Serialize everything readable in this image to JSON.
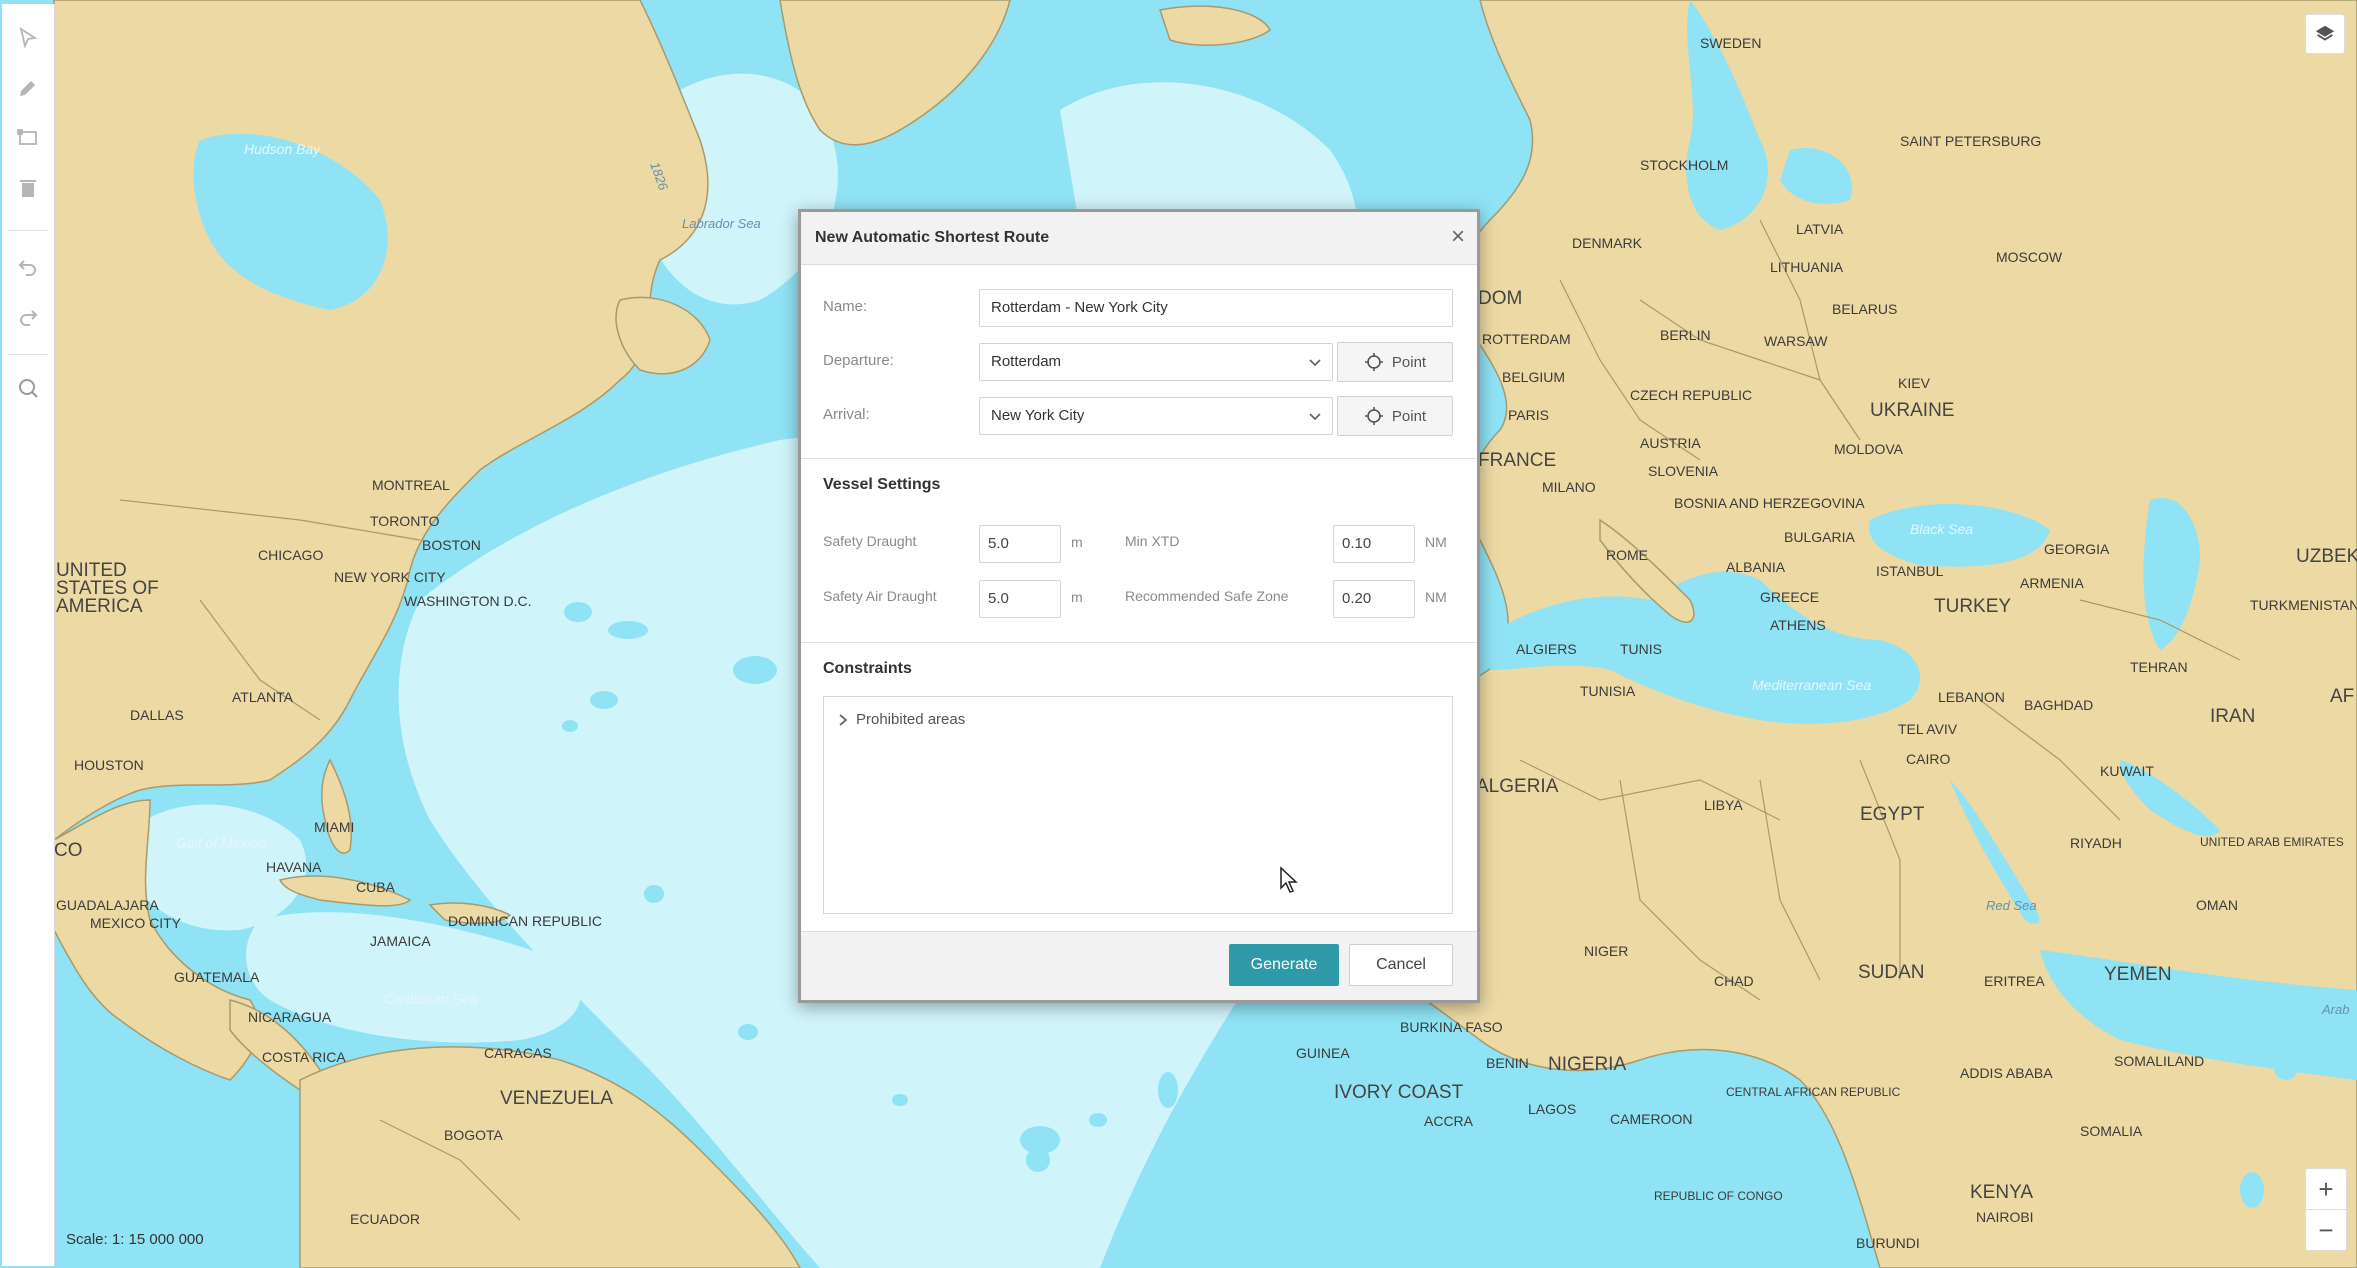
{
  "toolbar": {
    "tools": [
      {
        "name": "select-tool",
        "icon": "pointer-icon"
      },
      {
        "name": "draw-tool",
        "icon": "pencil-icon"
      },
      {
        "name": "area-tool",
        "icon": "rectangle-icon"
      },
      {
        "name": "delete-tool",
        "icon": "trash-icon"
      },
      {
        "name": "undo-tool",
        "icon": "undo-icon"
      },
      {
        "name": "redo-tool",
        "icon": "redo-icon"
      },
      {
        "name": "search-tool",
        "icon": "search-icon"
      }
    ]
  },
  "map": {
    "scale_text": "Scale: 1: 15 000 000",
    "zoom_in": "+",
    "zoom_out": "−",
    "layers_icon": "layers-icon",
    "colors": {
      "water": "#8fe3f4",
      "deep_water": "#cff4fa",
      "land": "#ecd9a4",
      "border": "#a89a6c"
    },
    "labels": {
      "hudson_bay": "Hudson Bay",
      "labrador_sea": "Labrador Sea",
      "usa": [
        "UNITED",
        "STATES OF",
        "AMERICA"
      ],
      "montreal": "MONTREAL",
      "toronto": "TORONTO",
      "boston": "BOSTON",
      "chicago": "CHICAGO",
      "new_york": "NEW YORK CITY",
      "washington": "WASHINGTON D.C.",
      "dallas": "DALLAS",
      "atlanta": "ATLANTA",
      "houston": "HOUSTON",
      "gulf_of_mexico": "Gulf of Mexico",
      "miami": "MIAMI",
      "havana": "HAVANA",
      "cuba": "CUBA",
      "mexico": "CO",
      "guadalajara": "GUADALAJARA",
      "mexico_city": "MEXICO CITY",
      "jamaica": "JAMAICA",
      "dominican_republic": "DOMINICAN REPUBLIC",
      "guatemala": "GUATEMALA",
      "nicaragua": "NICARAGUA",
      "costa_rica": "COSTA RICA",
      "caribbean_sea": "Caribbean Sea",
      "caracas": "CARACAS",
      "venezuela": "VENEZUELA",
      "bogota": "BOGOTA",
      "ecuador": "ECUADOR",
      "sweden": "SWEDEN",
      "stockholm": "STOCKHOLM",
      "saint_petersburg": "SAINT PETERSBURG",
      "moscow": "MOSCOW",
      "latvia": "LATVIA",
      "lithuania": "LITHUANIA",
      "belarus": "BELARUS",
      "denmark": "DENMARK",
      "berlin": "BERLIN",
      "warsaw": "WARSAW",
      "kiev": "KIEV",
      "ukraine": "UKRAINE",
      "moldova": "MOLDOVA",
      "czech": "CZECH REPUBLIC",
      "austria": "AUSTRIA",
      "slovenia": "SLOVENIA",
      "bosnia": "BOSNIA AND HERZEGOVINA",
      "bulgaria": "BULGARIA",
      "albania": "ALBANIA",
      "greece": "GREECE",
      "athens": "ATHENS",
      "istanbul": "ISTANBUL",
      "black_sea": "Black Sea",
      "georgia": "GEORGIA",
      "armenia": "ARMENIA",
      "turkey": "TURKEY",
      "uzbek": "UZBEK",
      "turkmenistan": "TURKMENISTAN",
      "tehran": "TEHRAN",
      "iran": "IRAN",
      "af": "AF",
      "kingdom": "DOM",
      "rotterdam": "ROTTERDAM",
      "belgium": "BELGIUM",
      "paris": "PARIS",
      "france": "FRANCE",
      "milano": "MILANO",
      "rome": "ROME",
      "algiers": "ALGIERS",
      "tunis": "TUNIS",
      "tunisia": "TUNISIA",
      "algeria": "ALGERIA",
      "libya": "LIBYA",
      "egypt": "EGYPT",
      "cairo": "CAIRO",
      "tel_aviv": "TEL AVIV",
      "lebanon": "LEBANON",
      "baghdad": "BAGHDAD",
      "kuwait": "KUWAIT",
      "riyadh": "RIYADH",
      "uae": "UNITED ARAB EMIRATES",
      "oman": "OMAN",
      "yemen": "YEMEN",
      "sudan": "SUDAN",
      "eritrea": "ERITREA",
      "red_sea": "Red Sea",
      "chad": "CHAD",
      "niger": "NIGER",
      "nigeria": "NIGERIA",
      "benin": "BENIN",
      "burkina": "BURKINA FASO",
      "guinea": "GUINEA",
      "ivory_coast": "IVORY COAST",
      "accra": "ACCRA",
      "lagos": "LAGOS",
      "cameroon": "CAMEROON",
      "car": "CENTRAL AFRICAN REPUBLIC",
      "congo": "REPUBLIC OF CONGO",
      "burundi": "BURUNDI",
      "kenya": "KENYA",
      "nairobi": "NAIROBI",
      "somalia": "SOMALIA",
      "somaliland": "SOMALILAND",
      "addis": "ADDIS ABABA",
      "med_sea": "Mediterranean Sea",
      "arab": "Arab",
      "mid_atlantic": "1826"
    }
  },
  "dialog": {
    "title": "New Automatic Shortest Route",
    "close": "×",
    "name_label": "Name:",
    "name_value": "Rotterdam - New York City",
    "departure_label": "Departure:",
    "departure_value": "Rotterdam",
    "arrival_label": "Arrival:",
    "arrival_value": "New York City",
    "point_label": "Point",
    "vessel_heading": "Vessel Settings",
    "safety_draught_label": "Safety Draught",
    "safety_draught_value": "5.0",
    "safety_draught_unit": "m",
    "safety_air_label": "Safety Air Draught",
    "safety_air_value": "5.0",
    "safety_air_unit": "m",
    "min_xtd_label": "Min XTD",
    "min_xtd_value": "0.10",
    "min_xtd_unit": "NM",
    "safe_zone_label": "Recommended Safe Zone",
    "safe_zone_value": "0.20",
    "safe_zone_unit": "NM",
    "constraints_heading": "Constraints",
    "prohibited_label": "Prohibited areas",
    "generate_label": "Generate",
    "cancel_label": "Cancel",
    "accent": "#2e9aa8"
  }
}
